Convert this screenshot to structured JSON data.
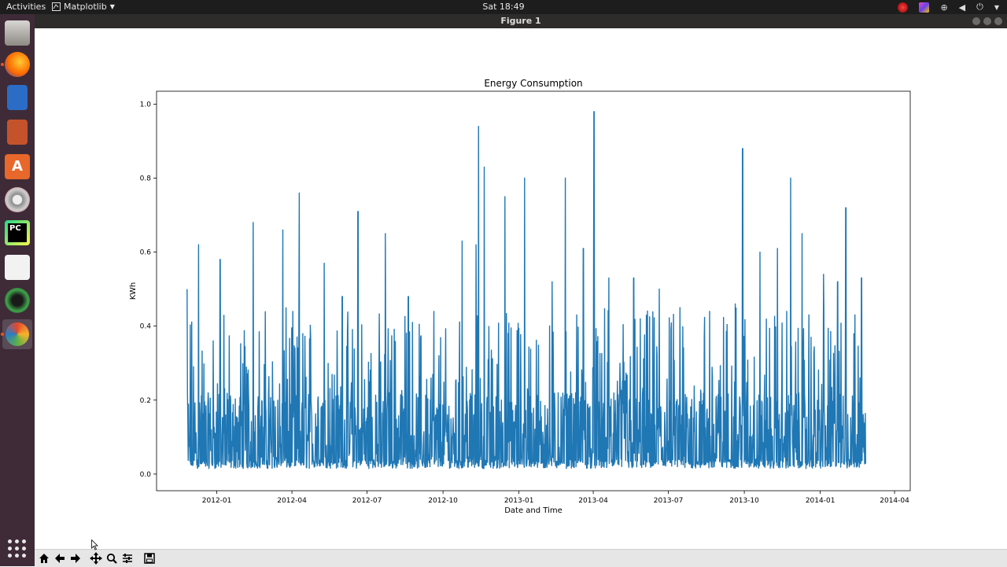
{
  "topbar": {
    "activities": "Activities",
    "app_menu": "Matplotlib",
    "clock": "Sat 18:49"
  },
  "window": {
    "title": "Figure 1"
  },
  "dock": {
    "apps": [
      "file-manager-icon",
      "firefox-icon",
      "writer-icon",
      "impress-icon",
      "software-center-icon",
      "settings-icon",
      "pycharm-icon",
      "text-editor-icon",
      "camera-icon",
      "matplotlib-icon"
    ]
  },
  "toolbar": {
    "buttons": [
      "home-icon",
      "back-icon",
      "forward-icon",
      "pan-icon",
      "zoom-icon",
      "configure-subplots-icon",
      "save-icon"
    ]
  },
  "colors": {
    "line": "#1f77b4",
    "topbar": "#1d1d1d",
    "dock": "#3e2b37"
  },
  "chart_data": {
    "type": "line",
    "title": "Energy Consumption",
    "xlabel": "Date and Time",
    "ylabel": "KWh",
    "xlim": [
      "2011-10-20",
      "2014-04-20"
    ],
    "ylim": [
      -0.045,
      1.035
    ],
    "x_ticks": [
      "2012-01",
      "2012-04",
      "2012-07",
      "2012-10",
      "2013-01",
      "2013-04",
      "2013-07",
      "2013-10",
      "2014-01",
      "2014-04"
    ],
    "y_ticks": [
      "0.0",
      "0.2",
      "0.4",
      "0.6",
      "0.8",
      "1.0"
    ],
    "series": [
      {
        "x": [
          "2011-11-26",
          "2011-12-10",
          "2012-01-05",
          "2012-02-14",
          "2012-03-21",
          "2012-04-10",
          "2012-05-10",
          "2012-06-01",
          "2012-06-20",
          "2012-07-23",
          "2012-08-20",
          "2012-09-20",
          "2012-10-24",
          "2012-11-10",
          "2012-11-13",
          "2012-11-20",
          "2012-12-15",
          "2013-01-08",
          "2013-02-10",
          "2013-02-26",
          "2013-03-20",
          "2013-04-02",
          "2013-04-20",
          "2013-05-20",
          "2013-06-20",
          "2013-07-15",
          "2013-08-20",
          "2013-09-20",
          "2013-09-29",
          "2013-10-20",
          "2013-11-10",
          "2013-11-26",
          "2013-12-10",
          "2014-01-05",
          "2014-01-22",
          "2014-02-01",
          "2014-02-20"
        ],
        "peaks": [
          0.5,
          0.62,
          0.58,
          0.68,
          0.66,
          0.76,
          0.57,
          0.48,
          0.71,
          0.65,
          0.48,
          0.44,
          0.63,
          0.62,
          0.94,
          0.83,
          0.75,
          0.8,
          0.52,
          0.8,
          0.61,
          0.98,
          0.53,
          0.53,
          0.5,
          0.45,
          0.44,
          0.46,
          0.88,
          0.6,
          0.61,
          0.8,
          0.65,
          0.54,
          0.52,
          0.72,
          0.53
        ],
        "baseline": [
          0.015,
          0.04
        ]
      }
    ]
  }
}
